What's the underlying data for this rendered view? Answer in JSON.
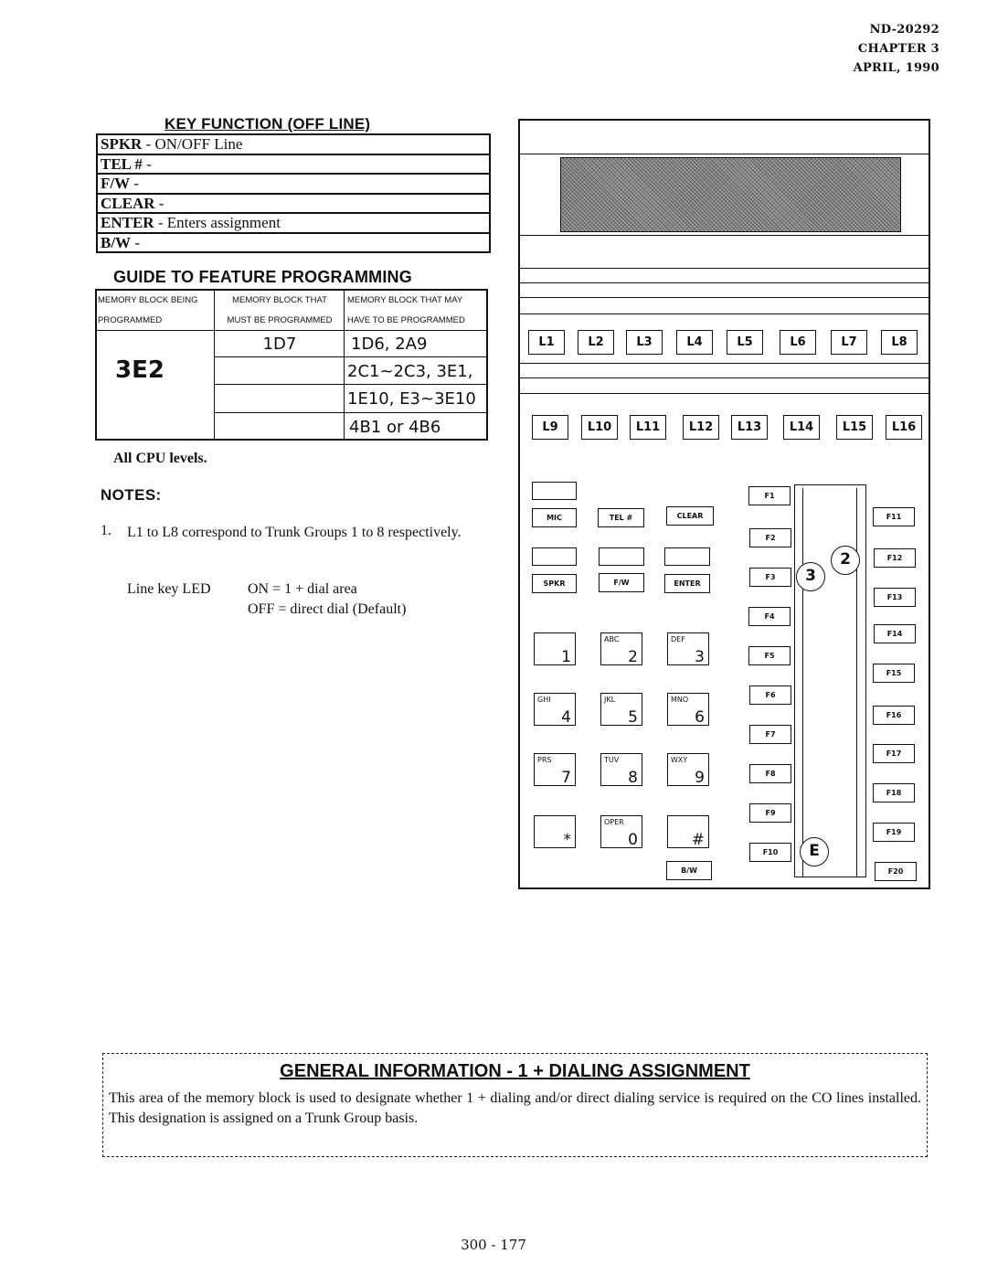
{
  "header": {
    "doc_number": "ND-20292",
    "chapter": "CHAPTER 3",
    "date": "APRIL, 1990"
  },
  "key_function": {
    "title": "KEY FUNCTION (OFF LINE)",
    "rows": [
      {
        "key": "SPKR",
        "desc": " -  ON/OFF Line"
      },
      {
        "key": "TEL #",
        "desc": " -"
      },
      {
        "key": "F/W",
        "desc": " -"
      },
      {
        "key": "CLEAR",
        "desc": " -"
      },
      {
        "key": "ENTER",
        "desc": " - Enters assignment"
      },
      {
        "key": "B/W",
        "desc": " -"
      }
    ]
  },
  "guide": {
    "title": "GUIDE TO FEATURE PROGRAMMING",
    "headers": [
      [
        "MEMORY BLOCK BEING",
        "PROGRAMMED"
      ],
      [
        "MEMORY BLOCK THAT",
        "MUST BE PROGRAMMED"
      ],
      [
        "MEMORY BLOCK THAT MAY",
        "HAVE TO BE PROGRAMMED"
      ]
    ],
    "block_programmed": "3E2",
    "must_be_programmed": [
      "1D7",
      "",
      "",
      ""
    ],
    "may_be_programmed": [
      "1D6, 2A9",
      "2C1~2C3,  3E1,",
      "1E10, E3~3E10",
      "4B1 or 4B6"
    ]
  },
  "cpu_levels": "All CPU levels.",
  "notes": {
    "title": "NOTES:",
    "items": [
      {
        "num": "1.",
        "text": "L1 to L8 correspond to Trunk Groups 1 to 8 respectively."
      }
    ],
    "led_label": "Line key LED",
    "led_on": "ON   =  1 + dial area",
    "led_off": "OFF =  direct dial (Default)"
  },
  "phone": {
    "line_keys_row1": [
      "L1",
      "L2",
      "L3",
      "L4",
      "L5",
      "L6",
      "L7",
      "L8"
    ],
    "line_keys_row2": [
      "L9",
      "L10",
      "L11",
      "L12",
      "L13",
      "L14",
      "L15",
      "L16"
    ],
    "func_row1": [
      "MIC",
      "TEL #",
      "CLEAR"
    ],
    "func_row2": [
      "SPKR",
      "F/W",
      "ENTER"
    ],
    "dialpad": [
      {
        "letters": "",
        "digit": "1"
      },
      {
        "letters": "ABC",
        "digit": "2"
      },
      {
        "letters": "DEF",
        "digit": "3"
      },
      {
        "letters": "GHI",
        "digit": "4"
      },
      {
        "letters": "JKL",
        "digit": "5"
      },
      {
        "letters": "MNO",
        "digit": "6"
      },
      {
        "letters": "PRS",
        "digit": "7"
      },
      {
        "letters": "TUV",
        "digit": "8"
      },
      {
        "letters": "WXY",
        "digit": "9"
      },
      {
        "letters": "",
        "digit": "*"
      },
      {
        "letters": "OPER",
        "digit": "0"
      },
      {
        "letters": "",
        "digit": "#"
      }
    ],
    "bw_key": "B/W",
    "f_keys_left": [
      "F1",
      "F2",
      "F3",
      "F4",
      "F5",
      "F6",
      "F7",
      "F8",
      "F9",
      "F10"
    ],
    "f_keys_right": [
      "F11",
      "F12",
      "F13",
      "F14",
      "F15",
      "F16",
      "F17",
      "F18",
      "F19",
      "F20"
    ],
    "callouts": [
      "2",
      "3",
      "E"
    ]
  },
  "general_info": {
    "title": "GENERAL INFORMATION  -  1 +  DIALING ASSIGNMENT",
    "text": "This area of the memory block is used to designate whether 1 + dialing and/or direct dialing service is required on the CO lines installed.  This designation is assigned on a Trunk Group basis."
  },
  "page_number": "300 - 177"
}
